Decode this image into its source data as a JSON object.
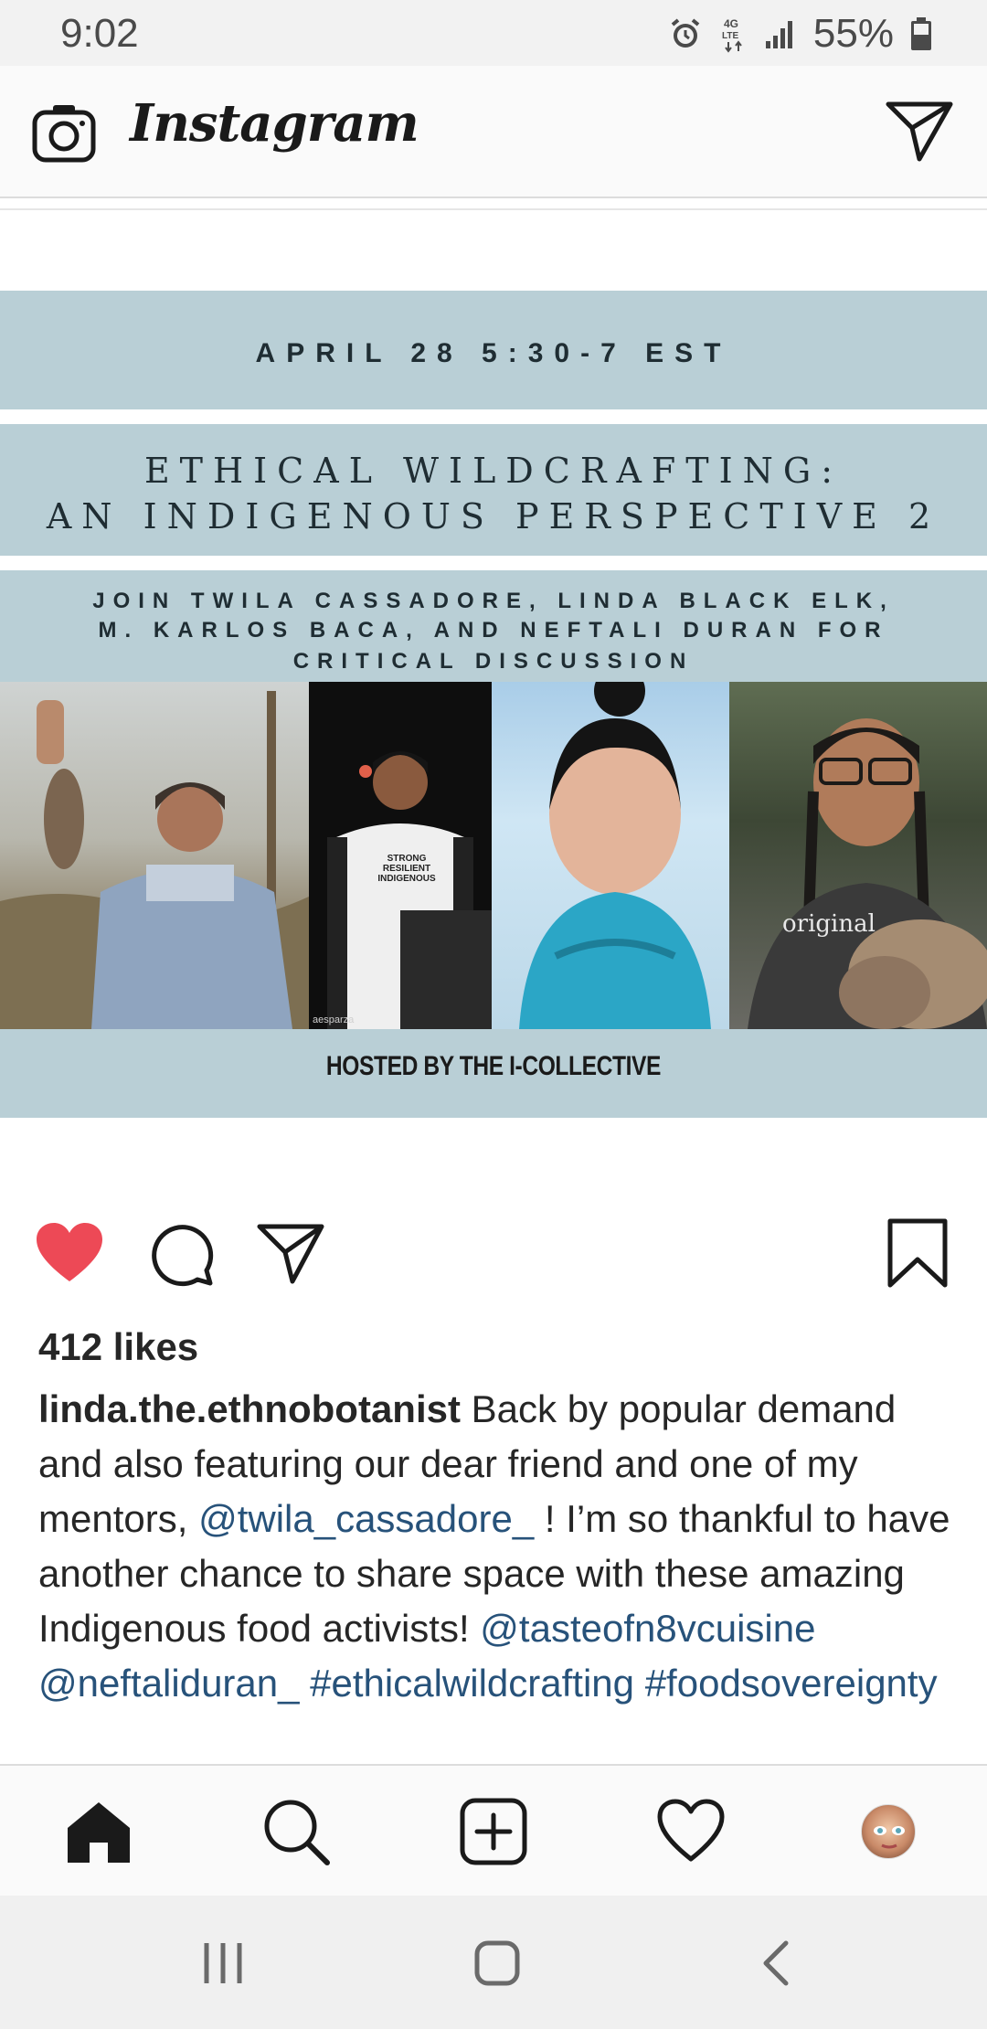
{
  "status_bar": {
    "time": "9:02",
    "network_label": "4G LTE",
    "battery": "55%"
  },
  "header": {
    "title": "Instagram",
    "icons": {
      "camera": "camera-icon",
      "direct": "paper-plane-icon"
    }
  },
  "post_image": {
    "date_line": "APRIL 28 5:30-7 EST",
    "title_line_1": "ETHICAL WILDCRAFTING:",
    "title_line_2": "AN INDIGENOUS PERSPECTIVE 2",
    "subtitle_line_1": "JOIN TWILA CASSADORE, LINDA BLACK ELK,",
    "subtitle_line_2": "M. KARLOS BACA, AND NEFTALI DURAN FOR",
    "subtitle_line_3": "CRITICAL DISCUSSION",
    "photo_watermark": "aesparza",
    "shirt_text_1": "STRONG RESILIENT INDIGENOUS",
    "shirt_text_2": "original",
    "host_line": "HOSTED BY THE I-COLLECTIVE",
    "background_color": "#b9cfd6"
  },
  "actions": {
    "like_state": "liked",
    "like_color": "#ed4956",
    "icons": [
      "heart-icon",
      "comment-icon",
      "share-icon",
      "bookmark-icon"
    ]
  },
  "post": {
    "likes": "412 likes",
    "username": "linda.the.ethnobotanist",
    "caption_1": " Back by popular demand and also featuring our dear friend and one of my mentors, ",
    "mention_1": "@twila_cassadore_",
    "caption_2": " ! I’m so thankful to have another chance to share space with these amazing Indigenous food activists! ",
    "mention_2": "@tasteofn8vcuisine",
    "mention_3": "@neftaliduran_",
    "hashtag_1": "#ethicalwildcrafting",
    "hashtag_2": "#foodsovereignty",
    "link_color": "#27527a"
  },
  "bottom_nav": {
    "items": [
      "home-icon",
      "search-icon",
      "add-post-icon",
      "activity-heart-icon",
      "profile-avatar"
    ],
    "active": "home"
  },
  "system_nav": {
    "items": [
      "recent-apps-icon",
      "home-circle-icon",
      "back-icon"
    ]
  }
}
